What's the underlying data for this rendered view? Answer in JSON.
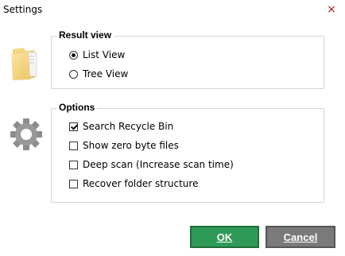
{
  "window": {
    "title": "Settings",
    "close_glyph": "×"
  },
  "result_view": {
    "title": "Result view",
    "options": [
      {
        "label": "List View",
        "selected": true
      },
      {
        "label": "Tree View",
        "selected": false
      }
    ]
  },
  "options": {
    "title": "Options",
    "items": [
      {
        "label": "Search Recycle Bin",
        "checked": true
      },
      {
        "label": "Show zero byte files",
        "checked": false
      },
      {
        "label": "Deep scan (Increase scan time)",
        "checked": false
      },
      {
        "label": "Recover folder structure",
        "checked": false
      }
    ]
  },
  "buttons": {
    "ok": "OK",
    "cancel": "Cancel"
  },
  "icons": {
    "result_view": "folder-icon",
    "options": "gear-icon"
  },
  "colors": {
    "ok_button": "#2f9a57",
    "cancel_button": "#7a7a7a",
    "close": "#b01818"
  }
}
